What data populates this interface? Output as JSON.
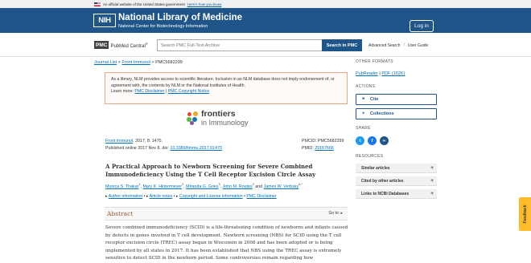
{
  "gov_banner": {
    "text": "An official website of the United States government",
    "link": "Here's how you know"
  },
  "header": {
    "logo": "NIH",
    "title": "National Library of Medicine",
    "subtitle": "National Center for Biotechnology Information",
    "login": "Log in"
  },
  "pmc_bar": {
    "logo_box": "PMC",
    "logo_text": "PubMed Central",
    "logo_reg": "®",
    "search_placeholder": "Search PMC Full-Text Archive",
    "search_button": "Search in PMC",
    "advanced_search": "Advanced Search",
    "separator": "|",
    "user_guide": "User Guide"
  },
  "breadcrumb": {
    "journal_list": "Journal List",
    "sep1": " > ",
    "journal": "Front Immunol",
    "sep2": " > ",
    "current": "PMC5682299"
  },
  "notice": {
    "text": "As a library, NLM provides access to scientific literature. Inclusion in an NLM database does not imply endorsement of, or agreement with, the contents by NLM or the National Institutes of Health.",
    "learn_more": "Learn more: ",
    "disclaimer": "PMC Disclaimer",
    "pipe": " | ",
    "copyright": "PMC Copyright Notice"
  },
  "journal_logo": {
    "line1": "frontiers",
    "line2": "in Immunology",
    "dot_colors": [
      "#e8462c",
      "#f4a81d",
      "#62b446",
      "#1a75b5",
      "#8e4f9f"
    ]
  },
  "citation": {
    "journal": "Front Immunol",
    "details": ". 2017; 8: 1470.",
    "published": "Published online 2017 Nov 8. doi: ",
    "doi": "10.3389/fimmu.2017.01470",
    "pmcid": "PMCID: PMC5682299",
    "pmid_label": "PMID: ",
    "pmid": "29167666"
  },
  "article": {
    "title": "A Practical Approach to Newborn Screening for Severe Combined Immunodeficiency Using the T Cell Receptor Excision Circle Assay",
    "authors": [
      {
        "name": "Monica S. Thakar",
        "sup": "1"
      },
      {
        "name": "Mary K. Hintermeyer",
        "sup": "2"
      },
      {
        "name": "Miranda G. Gries",
        "sup": "3"
      },
      {
        "name": "John M. Routes",
        "sup": "2"
      },
      {
        "name": "James W. Verbsky",
        "sup": "4,*"
      }
    ],
    "sep_comma": ", ",
    "and": " and ",
    "info_links": {
      "author_info": "Author information",
      "article_notes": "Article notes",
      "copyright": "Copyright and License information",
      "disclaimer": "PMC Disclaimer",
      "bullet": "▸ ",
      "dot": " • "
    }
  },
  "abstract": {
    "title": "Abstract",
    "goto": "Go to: ",
    "goto_arrow": "▸",
    "body": "Severe combined immunodeficiency (SCID) is a life-threatening condition of newborns and infants caused by defects in genes involved in T cell development. Newborn screening (NBS) for SCID using the T cell receptor excision circle (TREC) assay began in Wisconsin in 2008 and has been adopted or is being implemented by all states in 2017. It has been established that NBS using the TREC assay is extremely sensitive to detect SCID in the newborn period. Some controversies remain regarding how"
  },
  "sidebar": {
    "other_formats": "OTHER FORMATS",
    "pubreader": "PubReader",
    "pipe": " | ",
    "pdf": "PDF (162K)",
    "actions": "ACTIONS",
    "cite": "Cite",
    "collections": "Collections",
    "share": "SHARE",
    "share_icons": [
      {
        "name": "twitter",
        "glyph": "t",
        "color": "#1d9bf0"
      },
      {
        "name": "facebook",
        "glyph": "f",
        "color": "#1877f2"
      },
      {
        "name": "permalink",
        "glyph": "∞",
        "color": "#20558a"
      }
    ],
    "resources": "RESOURCES",
    "resource_items": [
      "Similar articles",
      "Cited by other articles",
      "Links to NCBI Databases"
    ],
    "plus": "+"
  },
  "feedback": "Feedback"
}
